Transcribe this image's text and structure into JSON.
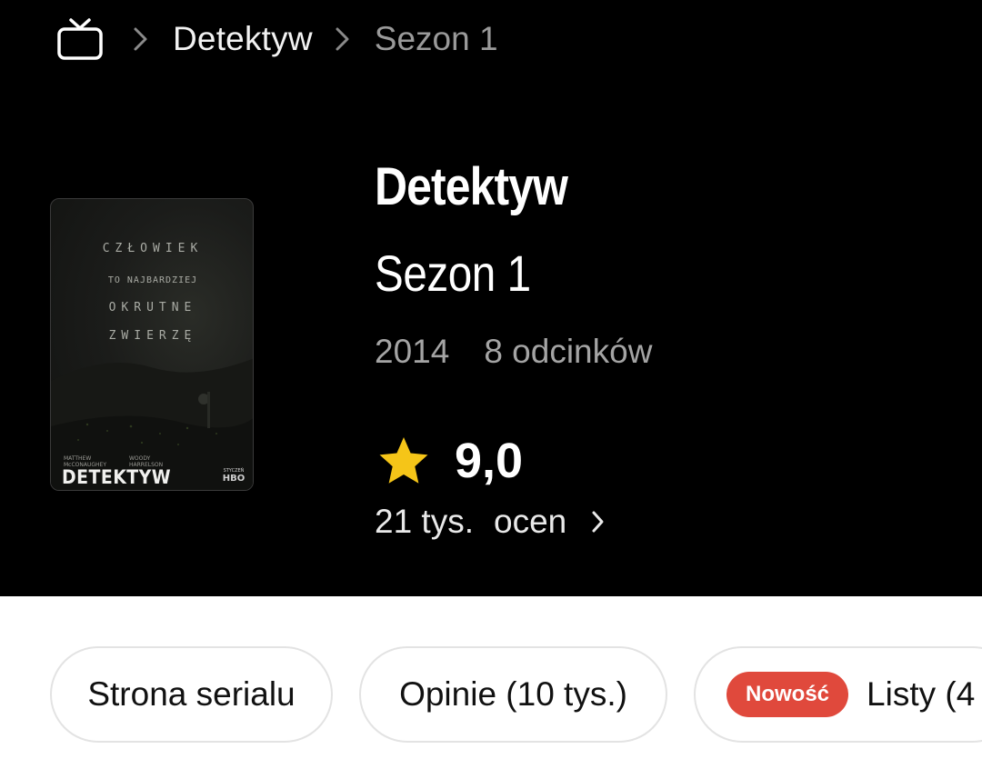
{
  "breadcrumb": {
    "home_icon": "tv-icon",
    "items": [
      "Detektyw",
      "Sezon 1"
    ]
  },
  "poster": {
    "tagline": [
      "CZŁOWIEK",
      "TO NAJBARDZIEJ",
      "OKRUTNE",
      "ZWIERZĘ"
    ],
    "actor_1": [
      "MATTHEW",
      "McCONAUGHEY"
    ],
    "actor_2": [
      "WOODY",
      "HARRELSON"
    ],
    "title": "DETEKTYW",
    "network_small": "STYCZEŃ",
    "network": "HBO"
  },
  "show": {
    "title": "Detektyw",
    "season": "Sezon 1",
    "year": "2014",
    "episodes": "8 odcinków"
  },
  "rating": {
    "value": "9,0",
    "votes_count": "21 tys.",
    "votes_label": "ocen",
    "star_color": "#f5c518"
  },
  "pills": {
    "series_page": "Strona serialu",
    "reviews": "Opinie (10 tys.)",
    "new_badge": "Nowość",
    "lists": "Listy (4"
  },
  "colors": {
    "background": "#000000",
    "badge": "#e0493c",
    "secondary_text": "#a4a4a4"
  }
}
